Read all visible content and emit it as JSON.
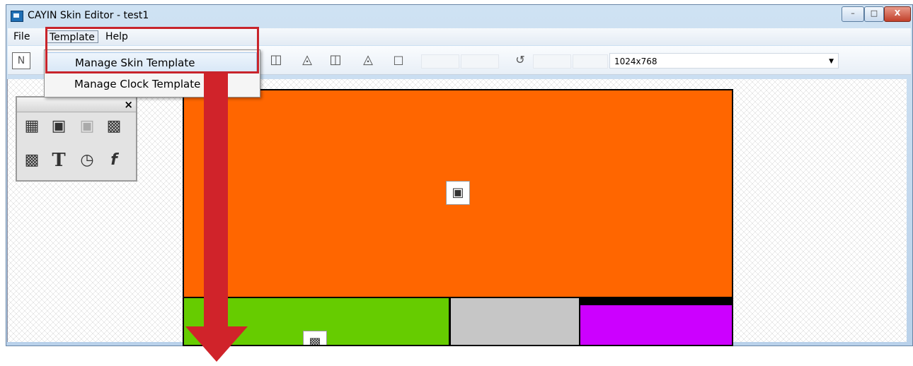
{
  "window": {
    "title": "CAYIN Skin Editor - test1",
    "controls": {
      "minimize": "–",
      "maximize": "□",
      "close": "X"
    }
  },
  "menubar": {
    "items": [
      {
        "label": "File"
      },
      {
        "label": "Template"
      },
      {
        "label": "Help"
      }
    ]
  },
  "template_menu": {
    "items": [
      {
        "label": "Manage Skin Template"
      },
      {
        "label": "Manage Clock Template"
      }
    ]
  },
  "toolbar": {
    "new_icon": "N",
    "resolution": "1024x768"
  },
  "palette": {
    "close": "×"
  },
  "colors": {
    "zone1": "#ff6600",
    "zone2": "#66cc00",
    "zone3": "#c6c6c6",
    "zone4": "#cc00ff",
    "annotation": "#d0232a"
  }
}
